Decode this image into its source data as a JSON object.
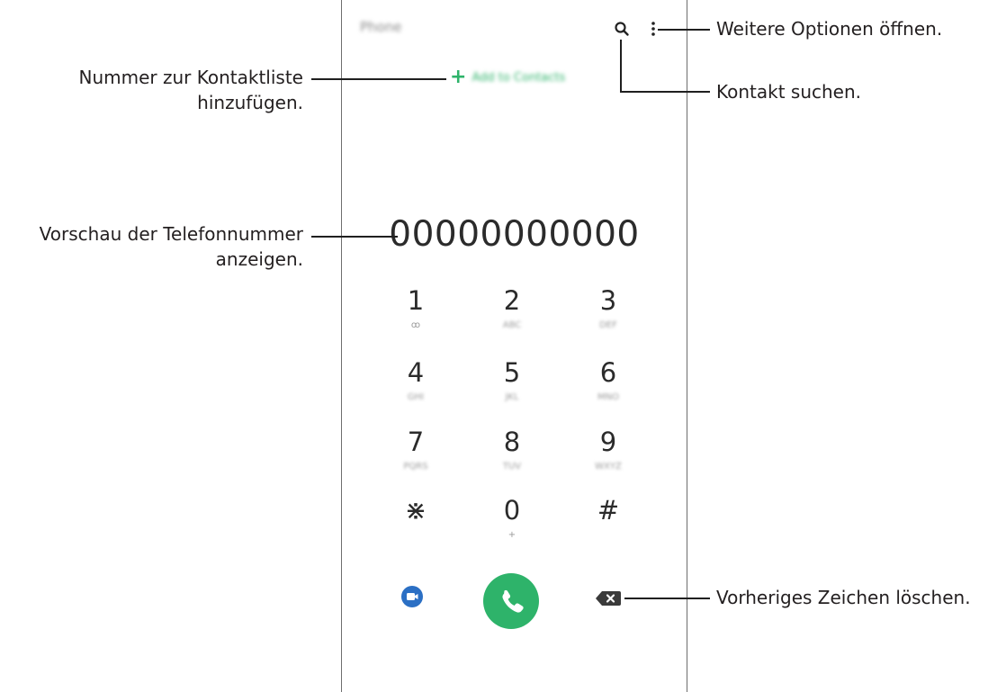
{
  "phone": {
    "app_title": "Phone",
    "add_to_contacts": "Add to Contacts",
    "number_preview": "00000000000",
    "keys": [
      {
        "digit": "1",
        "letters": "ꝏ"
      },
      {
        "digit": "2",
        "letters": "ABC"
      },
      {
        "digit": "3",
        "letters": "DEF"
      },
      {
        "digit": "4",
        "letters": "GHI"
      },
      {
        "digit": "5",
        "letters": "JKL"
      },
      {
        "digit": "6",
        "letters": "MNO"
      },
      {
        "digit": "7",
        "letters": "PQRS"
      },
      {
        "digit": "8",
        "letters": "TUV"
      },
      {
        "digit": "9",
        "letters": "WXYZ"
      },
      {
        "digit": "⋇",
        "letters": ""
      },
      {
        "digit": "0",
        "letters": "+"
      },
      {
        "digit": "#",
        "letters": ""
      }
    ],
    "icons": {
      "search": "search-icon",
      "more": "more-options-icon",
      "video": "video-call-icon",
      "call": "phone-icon",
      "backspace": "backspace-icon"
    },
    "colors": {
      "accent_green": "#2eb36a",
      "video_blue": "#2b6fc4"
    }
  },
  "callouts": {
    "add_contact": [
      "Nummer zur Kontaktliste",
      "hinzufügen."
    ],
    "preview": [
      "Vorschau der Telefonnummer",
      "anzeigen."
    ],
    "more_options": "Weitere Optionen öffnen.",
    "search": "Kontakt suchen.",
    "delete": "Vorheriges Zeichen löschen."
  }
}
